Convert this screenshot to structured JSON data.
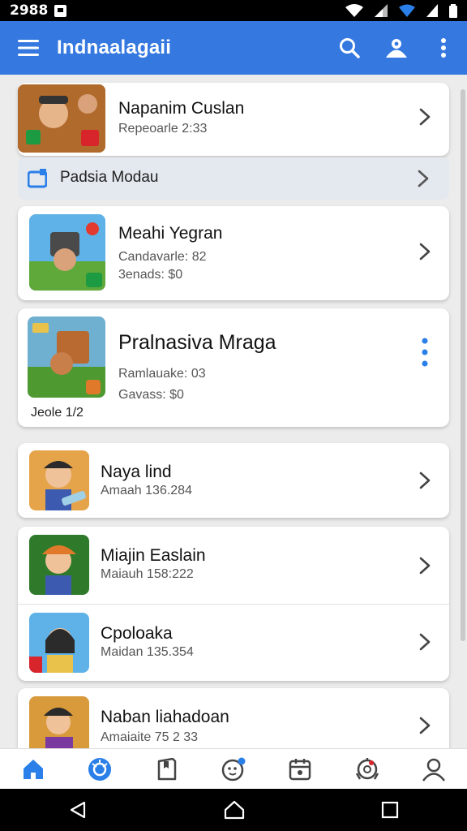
{
  "status_bar": {
    "time": "2988"
  },
  "app_bar": {
    "title": "Indnaalagaii"
  },
  "section": {
    "label": "Padsia Modau"
  },
  "cards": [
    {
      "title": "Napanim Cuslan",
      "sub1": "Repeoarle 2:33",
      "sub2": ""
    },
    {
      "title": "Meahi Yegran",
      "sub1": "Candavarle: 82",
      "sub2": "3enads: $0"
    },
    {
      "title": "Pralnasiva Mraga",
      "sub1": "Ramlauake: 03",
      "sub2": "Gavass: $0",
      "footer": "Jeole 1/2"
    },
    {
      "title": "Naya lind",
      "sub1": "Amaah 136.284"
    },
    {
      "title": "Miajin Easlain",
      "sub1": "Maiauh 158:222"
    },
    {
      "title": "Cpoloaka",
      "sub1": "Maidan 135.354"
    },
    {
      "title": "Naban liahadoan",
      "sub1": "Amaiaite 75 2 33"
    }
  ],
  "bottom_nav": [
    "home-icon",
    "explore-icon",
    "library-icon",
    "notifications-icon",
    "calendar-icon",
    "achievements-icon",
    "profile-icon"
  ],
  "colors": {
    "primary": "#3478e0",
    "accent": "#1f7ae0"
  }
}
